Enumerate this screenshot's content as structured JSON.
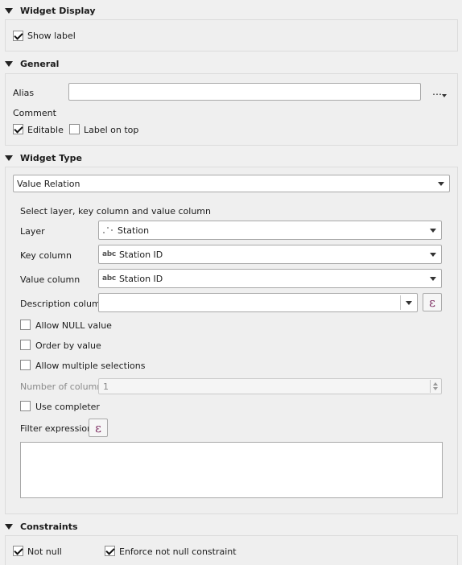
{
  "widget_display": {
    "title": "Widget Display",
    "show_label": {
      "label": "Show label",
      "checked": true
    }
  },
  "general": {
    "title": "General",
    "alias_label": "Alias",
    "alias_value": "",
    "more_button": "…",
    "comment_label": "Comment",
    "editable": {
      "label": "Editable",
      "checked": true
    },
    "label_on_top": {
      "label": "Label on top",
      "checked": false
    }
  },
  "widget_type": {
    "title": "Widget Type",
    "selected": "Value Relation",
    "instruction": "Select layer, key column and value column",
    "layer_label": "Layer",
    "layer_value": "Station",
    "key_column_label": "Key column",
    "key_column_value": "Station ID",
    "value_column_label": "Value column",
    "value_column_value": "Station ID",
    "field_type_badge": "abc",
    "description_column_label": "Description column",
    "description_column_value": "",
    "expression_icon": "ε",
    "allow_null": {
      "label": "Allow NULL value",
      "checked": false
    },
    "order_by_value": {
      "label": "Order by value",
      "checked": false
    },
    "allow_multiple": {
      "label": "Allow multiple selections",
      "checked": false
    },
    "num_columns_label": "Number of columns",
    "num_columns_value": "1",
    "use_completer": {
      "label": "Use completer",
      "checked": false
    },
    "filter_expression_label": "Filter expression",
    "filter_expression_value": ""
  },
  "constraints": {
    "title": "Constraints",
    "not_null": {
      "label": "Not null",
      "checked": true
    },
    "enforce_not_null": {
      "label": "Enforce not null constraint",
      "checked": true
    }
  }
}
